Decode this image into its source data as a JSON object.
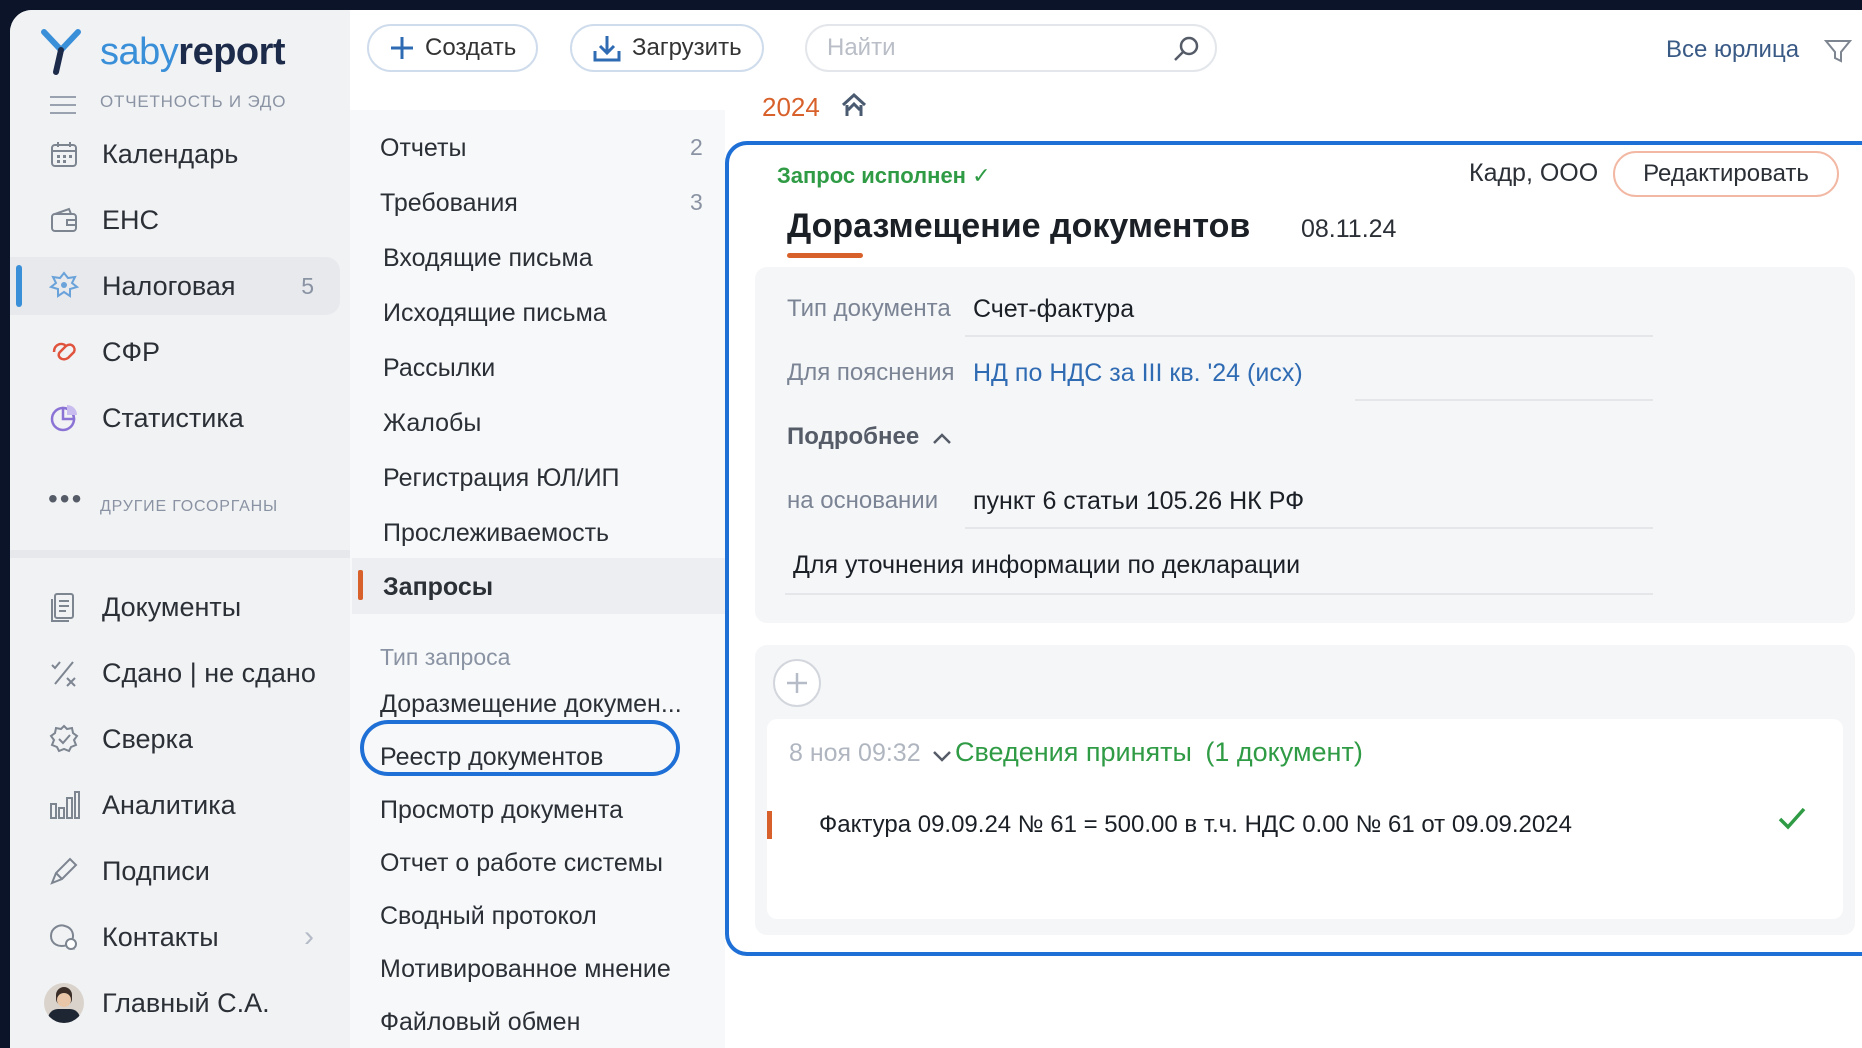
{
  "app": {
    "logo_a": "saby",
    "logo_b": "report"
  },
  "toolbar": {
    "create_label": "Создать",
    "upload_label": "Загрузить",
    "search_placeholder": "Найти",
    "entity_filter": "Все юрлица"
  },
  "sidebar": {
    "section_main": "ОТЧЕТНОСТЬ И ЭДО",
    "items": [
      {
        "label": "Календарь",
        "icon": "calendar-icon"
      },
      {
        "label": "ЕНС",
        "icon": "wallet-icon"
      },
      {
        "label": "Налоговая",
        "icon": "emblem-icon",
        "count": "5"
      },
      {
        "label": "СФР",
        "icon": "sfr-icon"
      },
      {
        "label": "Статистика",
        "icon": "pie-chart-icon"
      }
    ],
    "section_other": "ДРУГИЕ ГОСОРГАНЫ",
    "items2": [
      {
        "label": "Документы",
        "icon": "documents-icon"
      },
      {
        "label": "Сдано | не сдано",
        "icon": "submitted-icon"
      },
      {
        "label": "Сверка",
        "icon": "reconcile-icon"
      },
      {
        "label": "Аналитика",
        "icon": "bar-chart-icon"
      },
      {
        "label": "Подписи",
        "icon": "signature-icon"
      },
      {
        "label": "Контакты",
        "icon": "contacts-icon"
      },
      {
        "label": "Главный С.А.",
        "icon": "avatar"
      }
    ]
  },
  "breadcrumb": {
    "year": "2024"
  },
  "list": {
    "items": [
      {
        "label": "Отчеты",
        "count": "2"
      },
      {
        "label": "Требования",
        "count": "3"
      },
      {
        "label": "Входящие письма"
      },
      {
        "label": "Исходящие письма"
      },
      {
        "label": "Рассылки"
      },
      {
        "label": "Жалобы"
      },
      {
        "label": "Регистрация ЮЛ/ИП"
      },
      {
        "label": "Прослеживаемость"
      },
      {
        "label": "Запросы"
      }
    ],
    "group_label": "Тип запроса",
    "types": [
      "Доразмещение докумен...",
      "Реестр документов",
      "Просмотр документа",
      "Отчет о работе системы",
      "Сводный протокол",
      "Мотивированное мнение",
      "Файловый обмен"
    ]
  },
  "doc": {
    "status": "Запрос исполнен ✓",
    "company": "Кадр, ООО",
    "edit_label": "Редактировать",
    "title": "Доразмещение документов",
    "date": "08.11.24",
    "fields": {
      "type_label": "Тип документа",
      "type_value": "Счет-фактура",
      "for_label": "Для пояснения",
      "for_value": "НД по НДС за III кв. '24 (исх)",
      "more_label": "Подробнее",
      "basis_label": "на основании",
      "basis_value": "пункт 6 статьи 105.26 НК РФ"
    },
    "note": "Для уточнения информации по декларации"
  },
  "event": {
    "time": "8 ноя 09:32",
    "title": "Сведения приняты",
    "title_count": "(1 документ)",
    "line": "Фактура 09.09.24 № 61 = 500.00 в т.ч. НДС 0.00 № 61 от 09.09.2024"
  },
  "colors": {
    "accent": "#1e6fd6",
    "orange": "#d8612b",
    "green": "#2f9b45"
  }
}
